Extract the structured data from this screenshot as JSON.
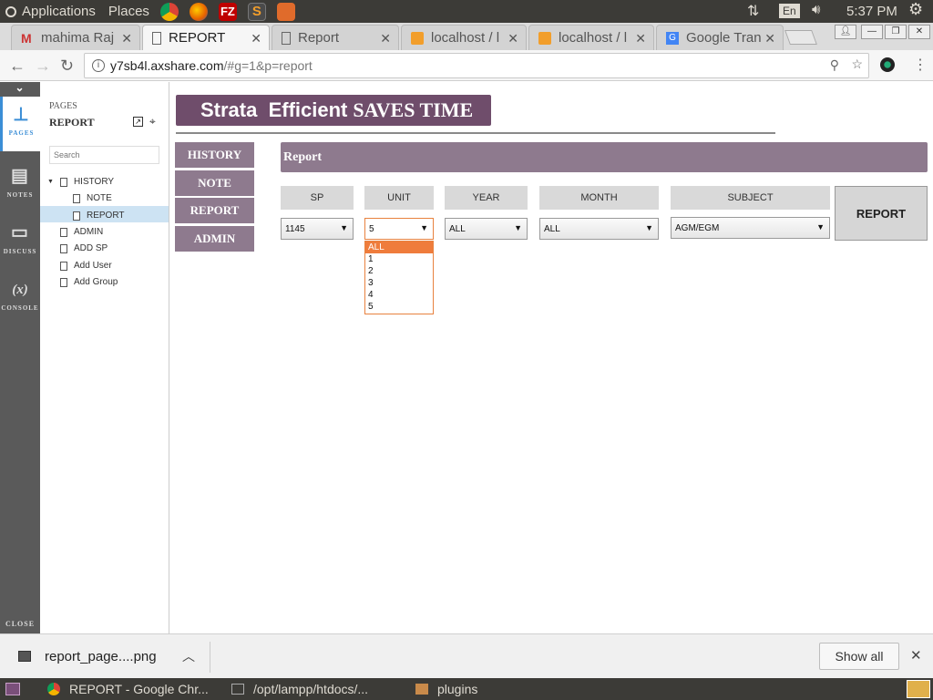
{
  "system": {
    "applications": "Applications",
    "places": "Places",
    "keyboard": "En",
    "time": "5:37 PM"
  },
  "tabs": [
    {
      "label": "mahima Raj",
      "favicon": "gmail-icon"
    },
    {
      "label": "REPORT",
      "favicon": "page-icon"
    },
    {
      "label": "Report",
      "favicon": "page-icon"
    },
    {
      "label": "localhost / l",
      "favicon": "phpmyadmin-icon"
    },
    {
      "label": "localhost / l",
      "favicon": "phpmyadmin-icon"
    },
    {
      "label": "Google Tran",
      "favicon": "google-translate-icon"
    }
  ],
  "url": {
    "host": "y7sb4l.axshare.com",
    "path": "/#g=1&p=report"
  },
  "rail": {
    "pages": "PAGES",
    "notes": "NOTES",
    "discuss": "DISCUSS",
    "console": "CONSOLE",
    "console_glyph": "(x)",
    "close": "CLOSE"
  },
  "sitemap": {
    "header": "PAGES",
    "current": "REPORT",
    "search_placeholder": "Search",
    "items": {
      "history": "HISTORY",
      "note": "NOTE",
      "report": "REPORT",
      "admin": "ADMIN",
      "add_sp": "ADD SP",
      "add_user": "Add User",
      "add_group": "Add Group"
    }
  },
  "banner": {
    "part1": "Strata  Efficient",
    "part2": "SAVES TIME"
  },
  "nav": {
    "history": "HISTORY",
    "note": "NOTE",
    "report": "REPORT",
    "admin": "ADMIN"
  },
  "report": {
    "title": "Report",
    "headers": {
      "sp": "SP",
      "unit": "UNIT",
      "year": "YEAR",
      "month": "MONTH",
      "subject": "SUBJECT"
    },
    "values": {
      "sp": "1145",
      "unit": "5",
      "year": "ALL",
      "month": "ALL",
      "subject": "AGM/EGM"
    },
    "button": "REPORT",
    "unit_options": [
      "ALL",
      "1",
      "2",
      "3",
      "4",
      "5"
    ]
  },
  "download": {
    "file": "report_page....png",
    "show_all": "Show all"
  },
  "taskbar": {
    "chrome": "REPORT - Google Chr...",
    "terminal": "/opt/lampp/htdocs/...",
    "files": "plugins"
  },
  "colors": {
    "accent": "#6f4d6b",
    "nav": "#8e7a8e",
    "highlight": "#ef7c3c"
  }
}
